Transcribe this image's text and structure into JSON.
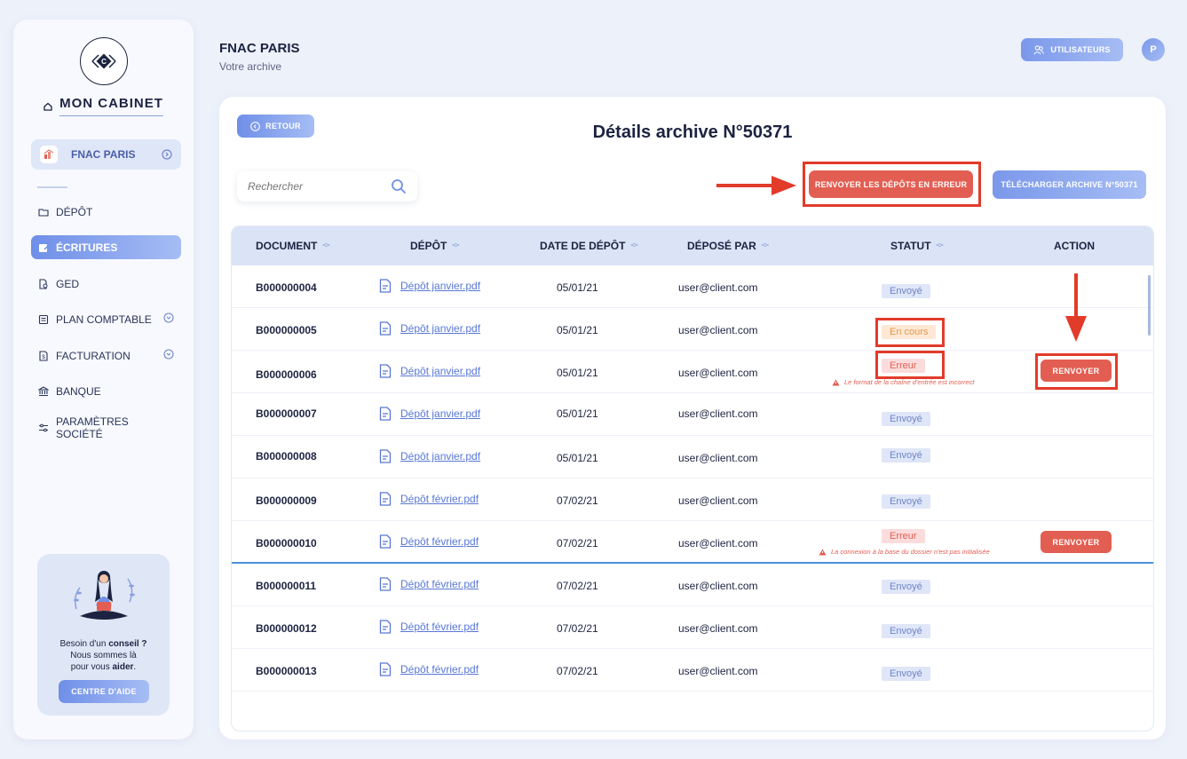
{
  "sidebar": {
    "brand": "MON CABINET",
    "client": "FNAC PARIS",
    "nav": [
      {
        "label": "DÉPÔT"
      },
      {
        "label": "ÉCRITURES"
      },
      {
        "label": "GED"
      },
      {
        "label": "PLAN COMPTABLE"
      },
      {
        "label": "FACTURATION"
      },
      {
        "label": "BANQUE"
      },
      {
        "label": "PARAMÈTRES SOCIÉTÉ"
      }
    ],
    "help": {
      "line1_pre": "Besoin d'un ",
      "line1_bold": "conseil ?",
      "line2": "Nous sommes là",
      "line3_pre": "pour vous ",
      "line3_bold": "aider",
      "line3_post": ".",
      "button": "CENTRE D'AIDE"
    }
  },
  "header": {
    "title": "FNAC PARIS",
    "subtitle": "Votre archive",
    "users_button": "UTILISATEURS",
    "avatar_initial": "P"
  },
  "main": {
    "back_button": "RETOUR",
    "title": "Détails archive N°50371",
    "search_placeholder": "Rechercher",
    "resend_errors_button": "RENVOYER LES DÉPÔTS EN ERREUR",
    "download_button": "TÉLÉCHARGER ARCHIVE N°50371",
    "columns": [
      "DOCUMENT",
      "DÉPÔT",
      "DATE DE DÉPÔT",
      "DÉPOSÉ PAR",
      "STATUT",
      "ACTION"
    ],
    "resend_label": "RENVOYER",
    "rows": [
      {
        "document": "B000000004",
        "file": "Dépôt janvier.pdf",
        "date": "05/01/21",
        "user": "user@client.com",
        "status": "Envoyé"
      },
      {
        "document": "B000000005",
        "file": "Dépôt janvier.pdf",
        "date": "05/01/21",
        "user": "user@client.com",
        "status": "En cours"
      },
      {
        "document": "B000000006",
        "file": "Dépôt janvier.pdf",
        "date": "05/01/21",
        "user": "user@client.com",
        "status": "Erreur",
        "error": "Le format de la chaîne d'entrée est incorrect"
      },
      {
        "document": "B000000007",
        "file": "Dépôt janvier.pdf",
        "date": "05/01/21",
        "user": "user@client.com",
        "status": "Envoyé"
      },
      {
        "document": "B000000008",
        "file": "Dépôt janvier.pdf",
        "date": "05/01/21",
        "user": "user@client.com",
        "status": "Envoyé"
      },
      {
        "document": "B000000009",
        "file": "Dépôt février.pdf",
        "date": "07/02/21",
        "user": "user@client.com",
        "status": "Envoyé"
      },
      {
        "document": "B000000010",
        "file": "Dépôt février.pdf",
        "date": "07/02/21",
        "user": "user@client.com",
        "status": "Erreur",
        "error": "La connexion à la base du dossier n'est pas initialisée"
      },
      {
        "document": "B000000011",
        "file": "Dépôt février.pdf",
        "date": "07/02/21",
        "user": "user@client.com",
        "status": "Envoyé"
      },
      {
        "document": "B000000012",
        "file": "Dépôt février.pdf",
        "date": "07/02/21",
        "user": "user@client.com",
        "status": "Envoyé"
      },
      {
        "document": "B000000013",
        "file": "Dépôt février.pdf",
        "date": "07/02/21",
        "user": "user@client.com",
        "status": "Envoyé"
      }
    ]
  },
  "colors": {
    "accent": "#6f8fe8",
    "danger": "#e35e52",
    "annotation": "#e23b2a",
    "background": "#edf1fa"
  }
}
